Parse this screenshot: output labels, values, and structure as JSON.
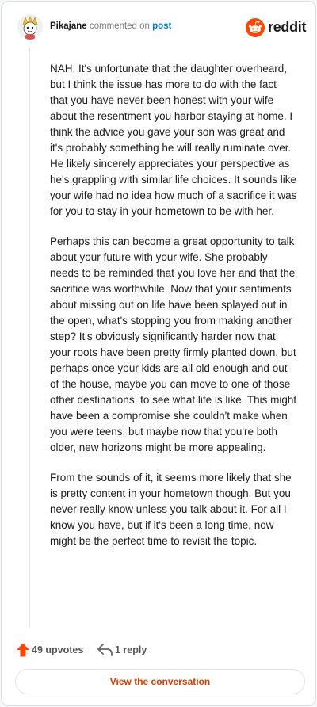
{
  "header": {
    "username": "Pikajane",
    "action_text": "commented on",
    "post_link": "post",
    "brand": "reddit"
  },
  "comment": {
    "paragraphs": [
      "NAH. It's unfortunate that the daughter overheard, but I think the issue has more to do with the fact that you have never been honest with your wife about the resentment you harbor staying at home. I think the advice you gave your son was great and it's probably something he will really ruminate over. He likely sincerely appreciates your perspective as he's grappling with similar life choices. It sounds like your wife had no idea how much of a sacrifice it was for you to stay in your hometown to be with her.",
      "Perhaps this can become a great opportunity to talk about your future with your wife. She probably needs to be reminded that you love her and that the sacrifice was worthwhile. Now that your sentiments about missing out on life have been splayed out in the open, what's stopping you from making another step? It's obviously significantly harder now that your roots have been pretty firmly planted down, but perhaps once your kids are all old enough and out of the house, maybe you can move to one of those other destinations, to see what life is like. This might have been a compromise she couldn't make when you were teens, but maybe now that you're both older, new horizons might be more appealing.",
      "From the sounds of it, it seems more likely that she is pretty content in your hometown though. But you never really know unless you talk about it. For all I know you have, but if it's been a long time, now might be the perfect time to revisit the topic."
    ]
  },
  "actions": {
    "upvotes_label": "49 upvotes",
    "replies_label": "1 reply",
    "view_conversation_label": "View the conversation"
  },
  "icons": {
    "avatar": "avatar-icon",
    "brand": "reddit-snoo-icon",
    "upvote": "upvote-arrow-icon",
    "reply": "reply-arrow-icon"
  },
  "colors": {
    "brand_orange": "#ff4500",
    "link_blue": "#0079d3",
    "cta_text": "#d93a00",
    "text": "#1c1c1c"
  }
}
